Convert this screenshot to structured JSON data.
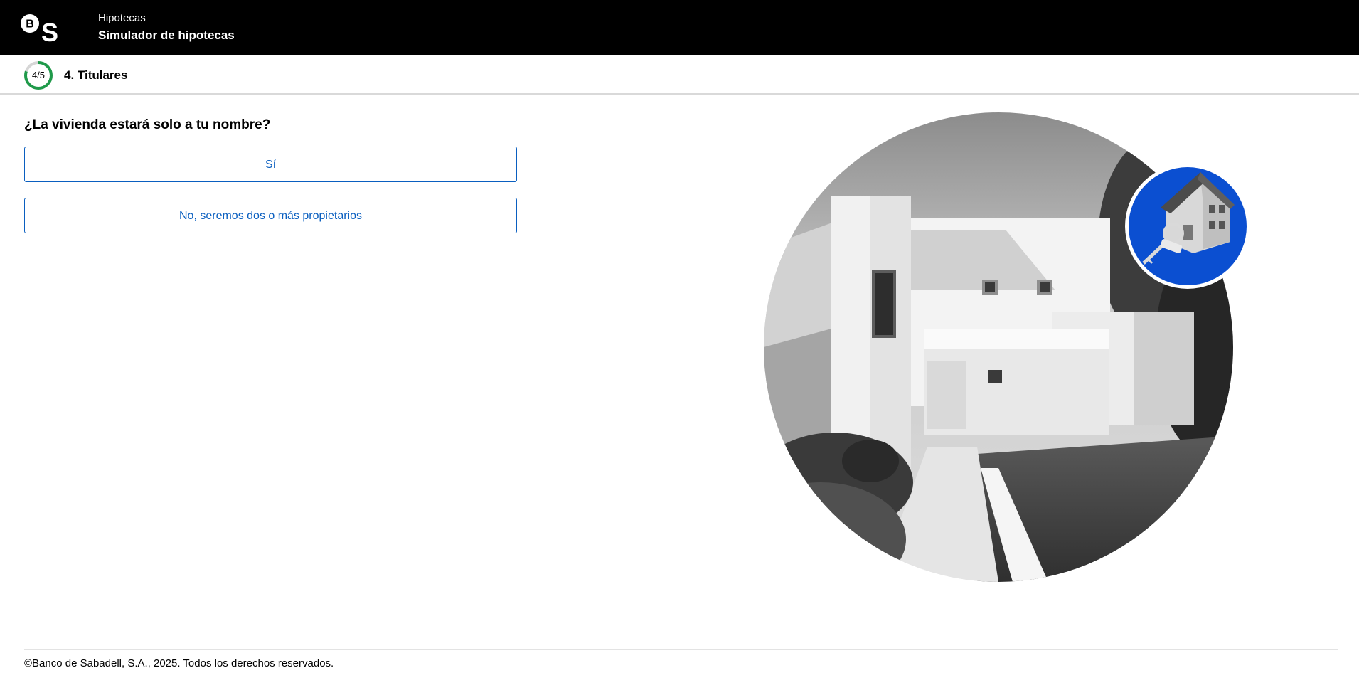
{
  "header": {
    "logo_text": "BS",
    "section": "Hipotecas",
    "title": "Simulador de hipotecas"
  },
  "stepper": {
    "count": "4/5",
    "progress": 0.8,
    "label": "4. Titulares",
    "ring_color": "#1f9a4a"
  },
  "main": {
    "question": "¿La vivienda estará solo a tu nombre?",
    "options": [
      {
        "label": "Sí"
      },
      {
        "label": "No, seremos dos o más propietarios"
      }
    ]
  },
  "colors": {
    "accent": "#0a5fc0",
    "badge_blue": "#0b4fd1",
    "header_bg": "#000000"
  },
  "footer": {
    "copyright": "©Banco de Sabadell, S.A., 2025. Todos los derechos reservados."
  }
}
